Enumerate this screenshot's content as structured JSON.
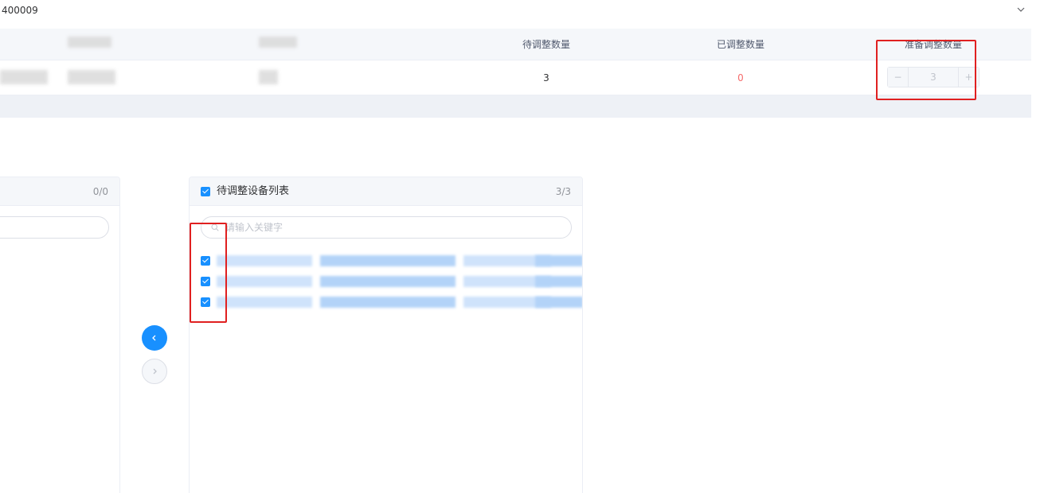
{
  "collapse": {
    "title": "400009",
    "arrow_icon": "chevron-down-icon"
  },
  "table": {
    "headers": [
      "",
      "",
      "待调整数量",
      "已调整数量",
      "准备调整数量"
    ],
    "row": {
      "pending_qty": "3",
      "adjusted_qty": "0",
      "prepare_qty": "3"
    }
  },
  "stepper": {
    "minus_label": "−",
    "plus_label": "+",
    "value": "3"
  },
  "left_panel": {
    "count": "0/0"
  },
  "right_panel": {
    "title": "待调整设备列表",
    "count": "3/3",
    "search_placeholder": "请输入关键字",
    "items_checked": [
      true,
      true,
      true
    ]
  },
  "transfer": {
    "left_icon": "chevron-left-icon",
    "right_icon": "chevron-right-icon"
  },
  "colors": {
    "primary": "#1890ff",
    "danger": "#f56c6c",
    "highlight_box": "#e02020"
  }
}
